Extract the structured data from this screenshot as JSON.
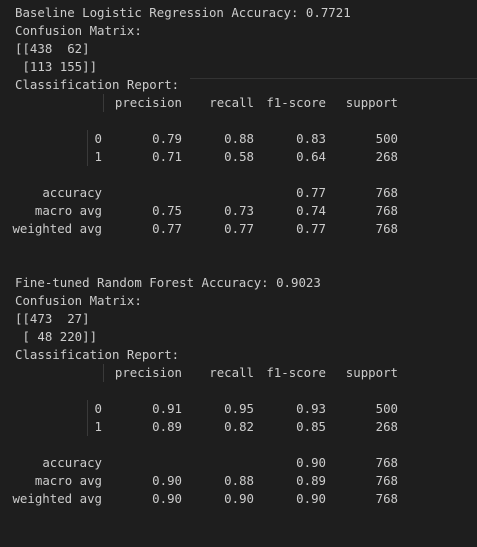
{
  "output": {
    "blocks": [
      {
        "accuracy_line": "Baseline Logistic Regression Accuracy: 0.7721",
        "cm_title": "Confusion Matrix:",
        "cm_row1": "[[438  62]",
        "cm_row2": " [113 155]]",
        "report_title": "Classification Report:",
        "headers": {
          "precision": "precision",
          "recall": "recall",
          "f1": "f1-score",
          "support": "support"
        },
        "classes": [
          {
            "label": "0",
            "precision": "0.79",
            "recall": "0.88",
            "f1": "0.83",
            "support": "500"
          },
          {
            "label": "1",
            "precision": "0.71",
            "recall": "0.58",
            "f1": "0.64",
            "support": "268"
          }
        ],
        "accuracy_row": {
          "label": "accuracy",
          "f1": "0.77",
          "support": "768"
        },
        "macro_avg": {
          "label": "macro avg",
          "precision": "0.75",
          "recall": "0.73",
          "f1": "0.74",
          "support": "768"
        },
        "weighted_avg": {
          "label": "weighted avg",
          "precision": "0.77",
          "recall": "0.77",
          "f1": "0.77",
          "support": "768"
        }
      },
      {
        "accuracy_line": "Fine-tuned Random Forest Accuracy: 0.9023",
        "cm_title": "Confusion Matrix:",
        "cm_row1": "[[473  27]",
        "cm_row2": " [ 48 220]]",
        "report_title": "Classification Report:",
        "headers": {
          "precision": "precision",
          "recall": "recall",
          "f1": "f1-score",
          "support": "support"
        },
        "classes": [
          {
            "label": "0",
            "precision": "0.91",
            "recall": "0.95",
            "f1": "0.93",
            "support": "500"
          },
          {
            "label": "1",
            "precision": "0.89",
            "recall": "0.82",
            "f1": "0.85",
            "support": "268"
          }
        ],
        "accuracy_row": {
          "label": "accuracy",
          "f1": "0.90",
          "support": "768"
        },
        "macro_avg": {
          "label": "macro avg",
          "precision": "0.90",
          "recall": "0.88",
          "f1": "0.89",
          "support": "768"
        },
        "weighted_avg": {
          "label": "weighted avg",
          "precision": "0.90",
          "recall": "0.90",
          "f1": "0.90",
          "support": "768"
        }
      }
    ]
  }
}
